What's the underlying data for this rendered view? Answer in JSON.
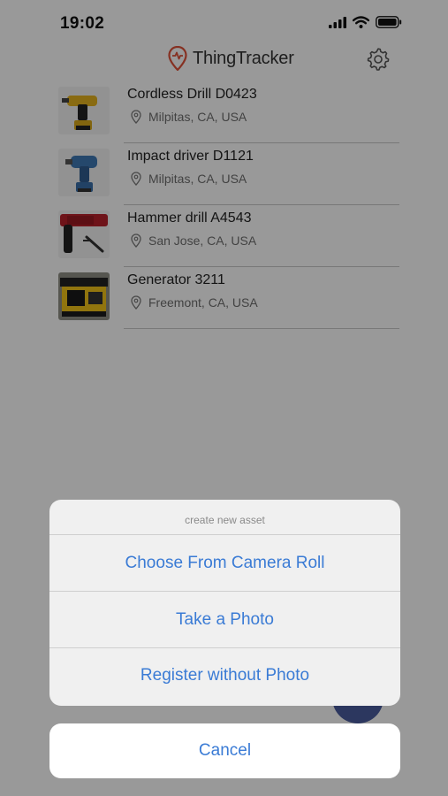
{
  "status_bar": {
    "time": "19:02",
    "icons": [
      "signal-icon",
      "wifi-icon",
      "battery-icon"
    ]
  },
  "header": {
    "app_name": "ThingTracker",
    "logo_icon": "map-pin-logo-icon",
    "settings_icon": "gear-icon",
    "brand_color": "#e0533a"
  },
  "assets": [
    {
      "name": "Cordless Drill D0423",
      "location": "Milpitas, CA, USA",
      "thumb": "cordless-drill"
    },
    {
      "name": "Impact driver D1121",
      "location": "Milpitas, CA, USA",
      "thumb": "impact-driver"
    },
    {
      "name": "Hammer drill A4543",
      "location": "San Jose, CA, USA",
      "thumb": "hammer-drill"
    },
    {
      "name": "Generator 3211",
      "location": "Freemont, CA, USA",
      "thumb": "generator"
    }
  ],
  "action_sheet": {
    "title": "create new asset",
    "options": [
      "Choose From Camera Roll",
      "Take a Photo",
      "Register without Photo"
    ],
    "cancel_label": "Cancel",
    "accent_color": "#3a7bd5"
  }
}
